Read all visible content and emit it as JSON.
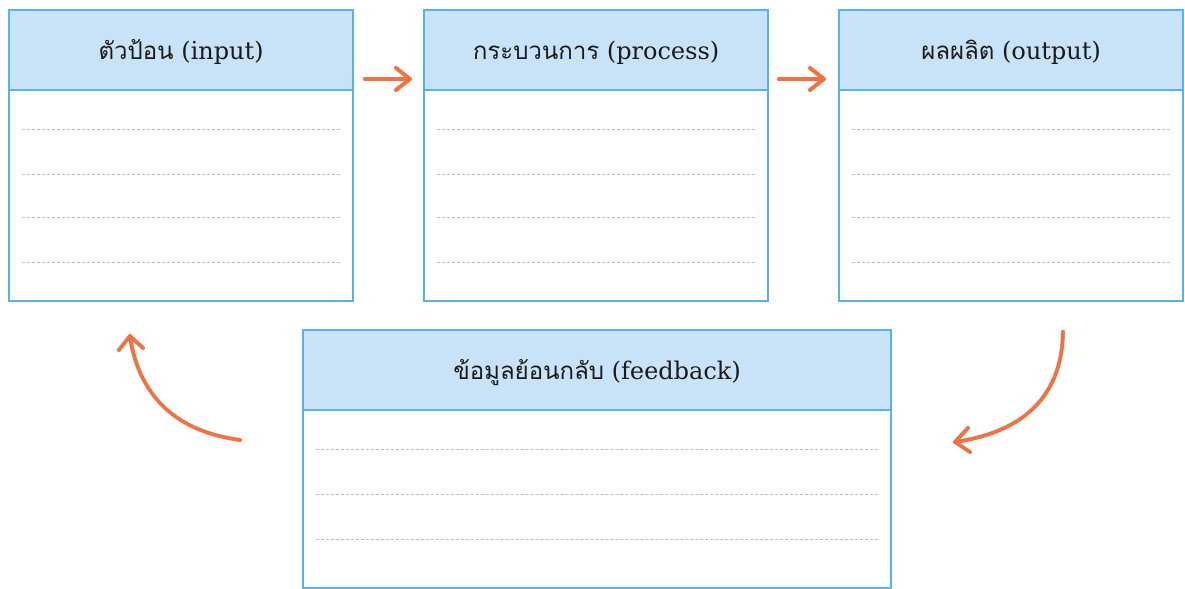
{
  "diagram": {
    "boxes": {
      "input": {
        "title": "ตัวป้อน (input)"
      },
      "process": {
        "title": "กระบวนการ (process)"
      },
      "output": {
        "title": "ผลผลิต (output)"
      },
      "feedback": {
        "title": "ข้อมูลย้อนกลับ (feedback)"
      }
    },
    "colors": {
      "header_fill": "#c8e3f7",
      "border": "#56b4e9",
      "arrow": "#ef7246",
      "rule_line": "#bdbdbd"
    },
    "arrows": [
      {
        "from": "input",
        "to": "process"
      },
      {
        "from": "process",
        "to": "output"
      },
      {
        "from": "output",
        "to": "feedback"
      },
      {
        "from": "feedback",
        "to": "input"
      }
    ]
  }
}
